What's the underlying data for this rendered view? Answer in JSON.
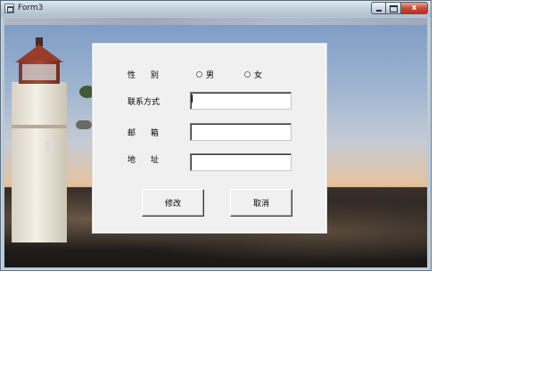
{
  "window": {
    "title": "Form3",
    "close_glyph": "x",
    "icon": "form-app-icon"
  },
  "form": {
    "gender_label": "性 别",
    "gender_options": [
      "男",
      "女"
    ],
    "contact_label": "联系方式",
    "contact_value": "",
    "email_label": "邮 箱",
    "email_value": "",
    "address_label": "地 址",
    "address_value": "",
    "modify_button": "修改",
    "cancel_button": "取消"
  }
}
